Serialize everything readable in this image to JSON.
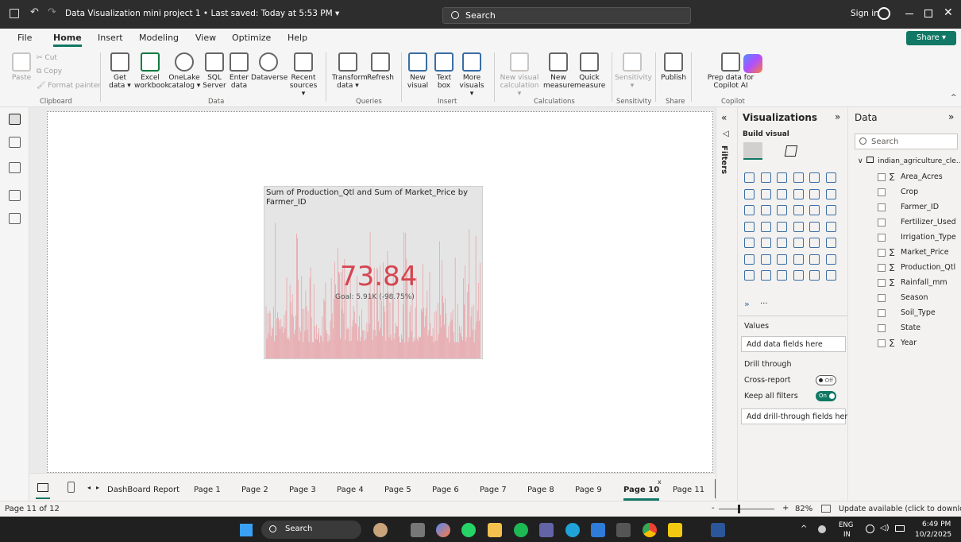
{
  "titlebar": {
    "title": "Data Visualization mini project 1 • Last saved: Today at 5:53 PM ▾",
    "search": "Search",
    "signin": "Sign in"
  },
  "menu": [
    "File",
    "Home",
    "Insert",
    "Modeling",
    "View",
    "Optimize",
    "Help"
  ],
  "share": "Share",
  "ribbon": {
    "cut": "Cut",
    "copy": "Copy",
    "paste": "Paste",
    "format_painter": "Format painter",
    "get_data": "Get data ▾",
    "excel": "Excel workbook",
    "onelake": "OneLake catalog ▾",
    "sql": "SQL Server",
    "enter": "Enter data",
    "dataverse": "Dataverse",
    "recent": "Recent sources ▾",
    "transform": "Transform data ▾",
    "refresh": "Refresh",
    "new_visual": "New visual",
    "text_box": "Text box",
    "more_visuals": "More visuals ▾",
    "new_visual_calc": "New visual calculation ▾",
    "new_measure": "New measure",
    "quick_measure": "Quick measure",
    "sensitivity": "Sensitivity ▾",
    "publish": "Publish",
    "copilot": "Prep data for Copilot AI",
    "groups": {
      "clipboard": "Clipboard",
      "data": "Data",
      "queries": "Queries",
      "insert": "Insert",
      "calculations": "Calculations",
      "sensitivity": "Sensitivity",
      "share": "Share",
      "copilot": "Copilot"
    }
  },
  "card": {
    "title": "Sum of Production_Qtl and Sum of Market_Price by Farmer_ID",
    "value": "73.84",
    "goal": "Goal: 5.91K (-98.75%)"
  },
  "tabs": [
    "DashBoard Report",
    "Page 1",
    "Page 2",
    "Page 3",
    "Page 4",
    "Page 5",
    "Page 6",
    "Page 7",
    "Page 8",
    "Page 9",
    "Page 10",
    "Page 11"
  ],
  "active_tab": "Page 10",
  "filters_label": "Filters",
  "visualizations": {
    "title": "Visualizations",
    "build_visual": "Build visual",
    "values": "Values",
    "add_data": "Add data fields here",
    "drill_through": "Drill through",
    "cross_report": "Cross-report",
    "cross_report_state": "Off",
    "keep_filters": "Keep all filters",
    "keep_filters_state": "On",
    "add_drill": "Add drill-through fields here",
    "more": "···"
  },
  "data_pane": {
    "title": "Data",
    "search_placeholder": "Search",
    "table": "indian_agriculture_cle...",
    "fields": [
      {
        "name": "Area_Acres",
        "sigma": true
      },
      {
        "name": "Crop",
        "sigma": false
      },
      {
        "name": "Farmer_ID",
        "sigma": false
      },
      {
        "name": "Fertilizer_Used",
        "sigma": false
      },
      {
        "name": "Irrigation_Type",
        "sigma": false
      },
      {
        "name": "Market_Price",
        "sigma": true
      },
      {
        "name": "Production_Qtl",
        "sigma": true
      },
      {
        "name": "Rainfall_mm",
        "sigma": true
      },
      {
        "name": "Season",
        "sigma": false
      },
      {
        "name": "Soil_Type",
        "sigma": false
      },
      {
        "name": "State",
        "sigma": false
      },
      {
        "name": "Year",
        "sigma": true
      }
    ]
  },
  "status": {
    "page": "Page 11 of 12",
    "zoom": "82%",
    "update": "Update available (click to download)"
  },
  "taskbar": {
    "search": "Search",
    "lang": "ENG",
    "region": "IN",
    "time": "6:49 PM",
    "date": "10/2/2025"
  },
  "colors": {
    "accent": "#117865",
    "kpi": "#d64550",
    "titlebar": "#2d2d2d"
  }
}
